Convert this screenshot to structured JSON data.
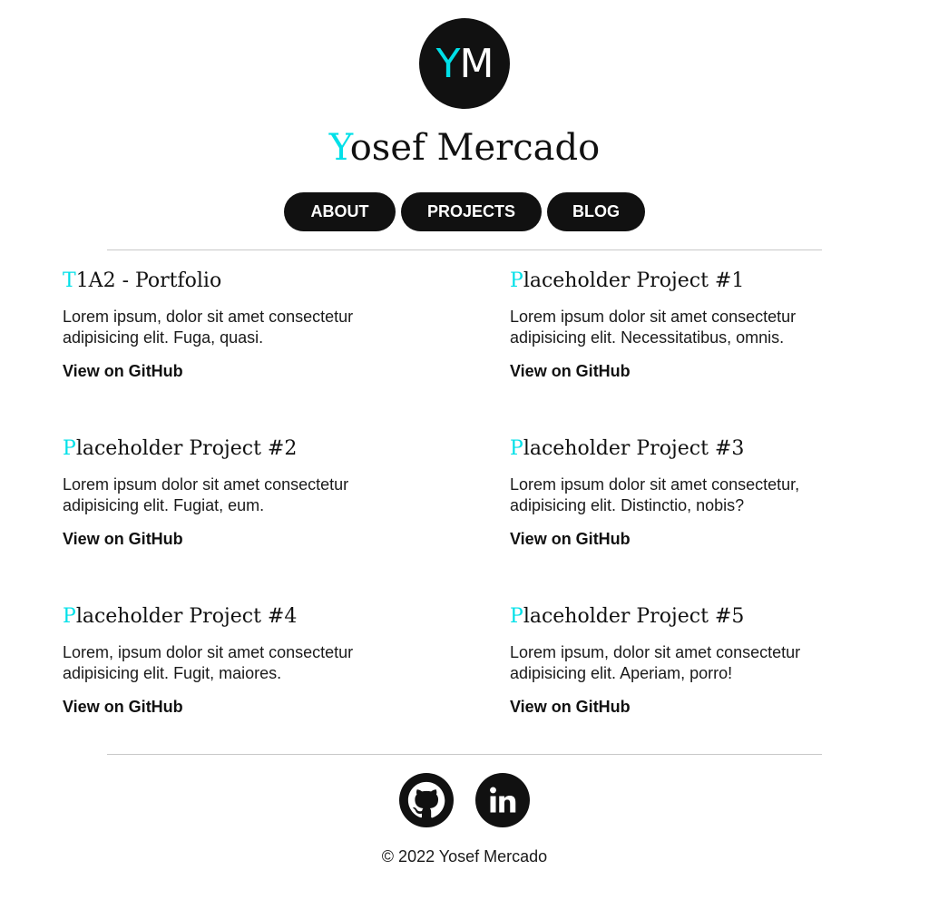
{
  "logo": {
    "first": "Y",
    "rest": "M"
  },
  "header": {
    "title_first": "Y",
    "title_rest": "osef Mercado"
  },
  "nav": {
    "items": [
      "ABOUT",
      "PROJECTS",
      "BLOG"
    ]
  },
  "projects": [
    {
      "title_first": "T",
      "title_rest": "1A2 - Portfolio",
      "description": "Lorem ipsum, dolor sit amet consectetur adipisicing elit. Fuga, quasi.",
      "link": "View on GitHub"
    },
    {
      "title_first": "P",
      "title_rest": "laceholder Project #1",
      "description": "Lorem ipsum dolor sit amet consectetur adipisicing elit. Necessitatibus, omnis.",
      "link": "View on GitHub"
    },
    {
      "title_first": "P",
      "title_rest": "laceholder Project #2",
      "description": "Lorem ipsum dolor sit amet consectetur adipisicing elit. Fugiat, eum.",
      "link": "View on GitHub"
    },
    {
      "title_first": "P",
      "title_rest": "laceholder Project #3",
      "description": "Lorem ipsum dolor sit amet consectetur, adipisicing elit. Distinctio, nobis?",
      "link": "View on GitHub"
    },
    {
      "title_first": "P",
      "title_rest": "laceholder Project #4",
      "description": "Lorem, ipsum dolor sit amet consectetur adipisicing elit. Fugit, maiores.",
      "link": "View on GitHub"
    },
    {
      "title_first": "P",
      "title_rest": "laceholder Project #5",
      "description": "Lorem ipsum, dolor sit amet consectetur adipisicing elit. Aperiam, porro!",
      "link": "View on GitHub"
    }
  ],
  "footer": {
    "social_icons": [
      "github-icon",
      "linkedin-icon"
    ],
    "copyright": "© 2022 Yosef Mercado"
  },
  "colors": {
    "accent": "#00e0e8",
    "dark": "#111111",
    "divider": "#c8c8c8"
  }
}
